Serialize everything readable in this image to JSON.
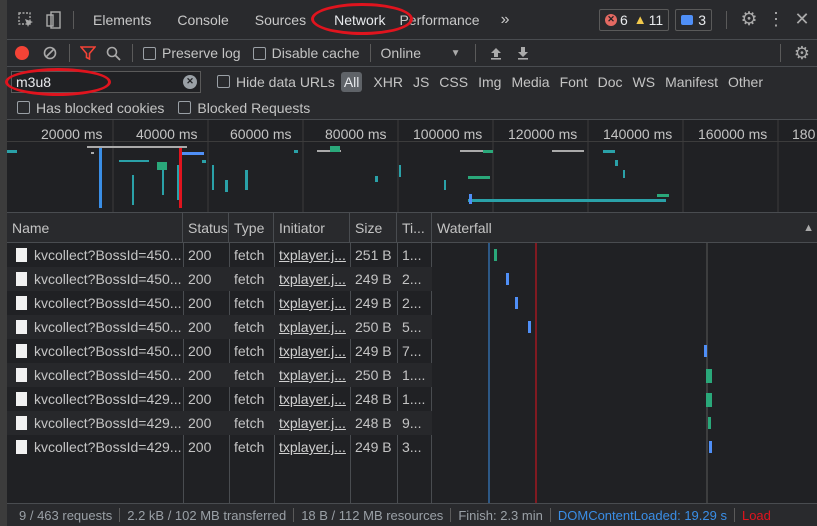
{
  "tabs": {
    "items": [
      "Elements",
      "Console",
      "Sources",
      "Network",
      "Performance"
    ],
    "more": "»",
    "errors": "6",
    "warnings": "11",
    "messages": "3"
  },
  "toolbar": {
    "preserve_log": "Preserve log",
    "disable_cache": "Disable cache",
    "throttle": "Online"
  },
  "filter": {
    "value": "m3u8",
    "hide_data_urls": "Hide data URLs",
    "types": [
      "All",
      "XHR",
      "JS",
      "CSS",
      "Img",
      "Media",
      "Font",
      "Doc",
      "WS",
      "Manifest",
      "Other"
    ],
    "has_blocked_cookies": "Has blocked cookies",
    "blocked_requests": "Blocked Requests"
  },
  "overview": {
    "ticks": [
      "20000 ms",
      "40000 ms",
      "60000 ms",
      "80000 ms",
      "100000 ms",
      "120000 ms",
      "140000 ms",
      "160000 ms",
      "180"
    ]
  },
  "table": {
    "columns": [
      "Name",
      "Status",
      "Type",
      "Initiator",
      "Size",
      "Ti...",
      "Waterfall"
    ],
    "sort_arrow": "▲",
    "rows": [
      {
        "name": "kvcollect?BossId=450...",
        "status": "200",
        "type": "fetch",
        "initiator": "txplayer.j...",
        "size": "251 B",
        "time": "1..."
      },
      {
        "name": "kvcollect?BossId=450...",
        "status": "200",
        "type": "fetch",
        "initiator": "txplayer.j...",
        "size": "249 B",
        "time": "2..."
      },
      {
        "name": "kvcollect?BossId=450...",
        "status": "200",
        "type": "fetch",
        "initiator": "txplayer.j...",
        "size": "249 B",
        "time": "2..."
      },
      {
        "name": "kvcollect?BossId=450...",
        "status": "200",
        "type": "fetch",
        "initiator": "txplayer.j...",
        "size": "250 B",
        "time": "5..."
      },
      {
        "name": "kvcollect?BossId=450...",
        "status": "200",
        "type": "fetch",
        "initiator": "txplayer.j...",
        "size": "249 B",
        "time": "7..."
      },
      {
        "name": "kvcollect?BossId=450...",
        "status": "200",
        "type": "fetch",
        "initiator": "txplayer.j...",
        "size": "250 B",
        "time": "1...."
      },
      {
        "name": "kvcollect?BossId=429...",
        "status": "200",
        "type": "fetch",
        "initiator": "txplayer.j...",
        "size": "248 B",
        "time": "1...."
      },
      {
        "name": "kvcollect?BossId=429...",
        "status": "200",
        "type": "fetch",
        "initiator": "txplayer.j...",
        "size": "248 B",
        "time": "9..."
      },
      {
        "name": "kvcollect?BossId=429...",
        "status": "200",
        "type": "fetch",
        "initiator": "txplayer.j...",
        "size": "249 B",
        "time": "3..."
      }
    ]
  },
  "statusbar": {
    "requests": "9 / 463 requests",
    "transferred": "2.2 kB / 102 MB transferred",
    "resources": "18 B / 112 MB resources",
    "finish": "Finish: 2.3 min",
    "domcontentloaded": "DOMContentLoaded: 19.29 s",
    "load": "Load"
  },
  "colors": {
    "accent_blue": "#4f8ff7",
    "dcl_blue": "#3a8ee6",
    "load_red": "#e0141e",
    "record_red": "#f44336",
    "annotation_red": "#e0141e"
  }
}
